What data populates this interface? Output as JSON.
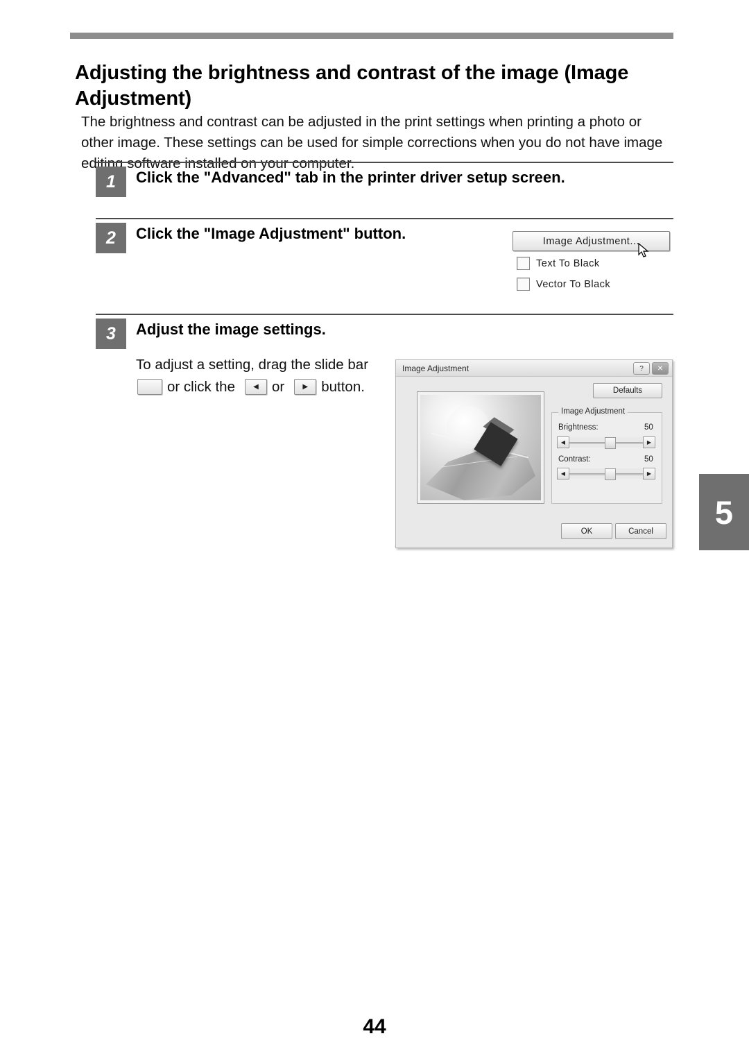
{
  "document": {
    "title": "Adjusting the brightness and contrast of the image (Image Adjustment)",
    "intro": "The brightness and contrast can be adjusted in the print settings when printing a photo or other image. These settings can be used for simple corrections when you do not have image editing software installed on your computer.",
    "page_number": "44",
    "chapter_tab": "5"
  },
  "steps": [
    {
      "number": "1",
      "heading": "Click the \"Advanced\" tab in the printer driver setup screen."
    },
    {
      "number": "2",
      "heading": "Click the \"Image Adjustment\" button."
    },
    {
      "number": "3",
      "heading": "Adjust the image settings."
    }
  ],
  "step2_figure": {
    "button_label": "Image Adjustment...",
    "checkbox_text_to_black": "Text To Black",
    "checkbox_vector_to_black": "Vector To Black",
    "cursor": "mouse-pointer"
  },
  "step3": {
    "text_part1": "To adjust a setting, drag the slide bar",
    "text_part2": "or click the",
    "text_part3": "or",
    "text_part4": "button.",
    "left_arrow_glyph": "◀",
    "right_arrow_glyph": "▶"
  },
  "dialog": {
    "title": "Image Adjustment",
    "help_button": "?",
    "close_button": "✕",
    "defaults_button": "Defaults",
    "group_label": "Image Adjustment",
    "sliders": [
      {
        "label": "Brightness:",
        "value": "50"
      },
      {
        "label": "Contrast:",
        "value": "50"
      }
    ],
    "ok_button": "OK",
    "cancel_button": "Cancel",
    "left_arrow_glyph": "◀",
    "right_arrow_glyph": "▶"
  },
  "colors": {
    "rule_gray": "#8d8d8d",
    "step_box_gray": "#6f6f6f",
    "tab_gray": "#6f6f6f"
  }
}
